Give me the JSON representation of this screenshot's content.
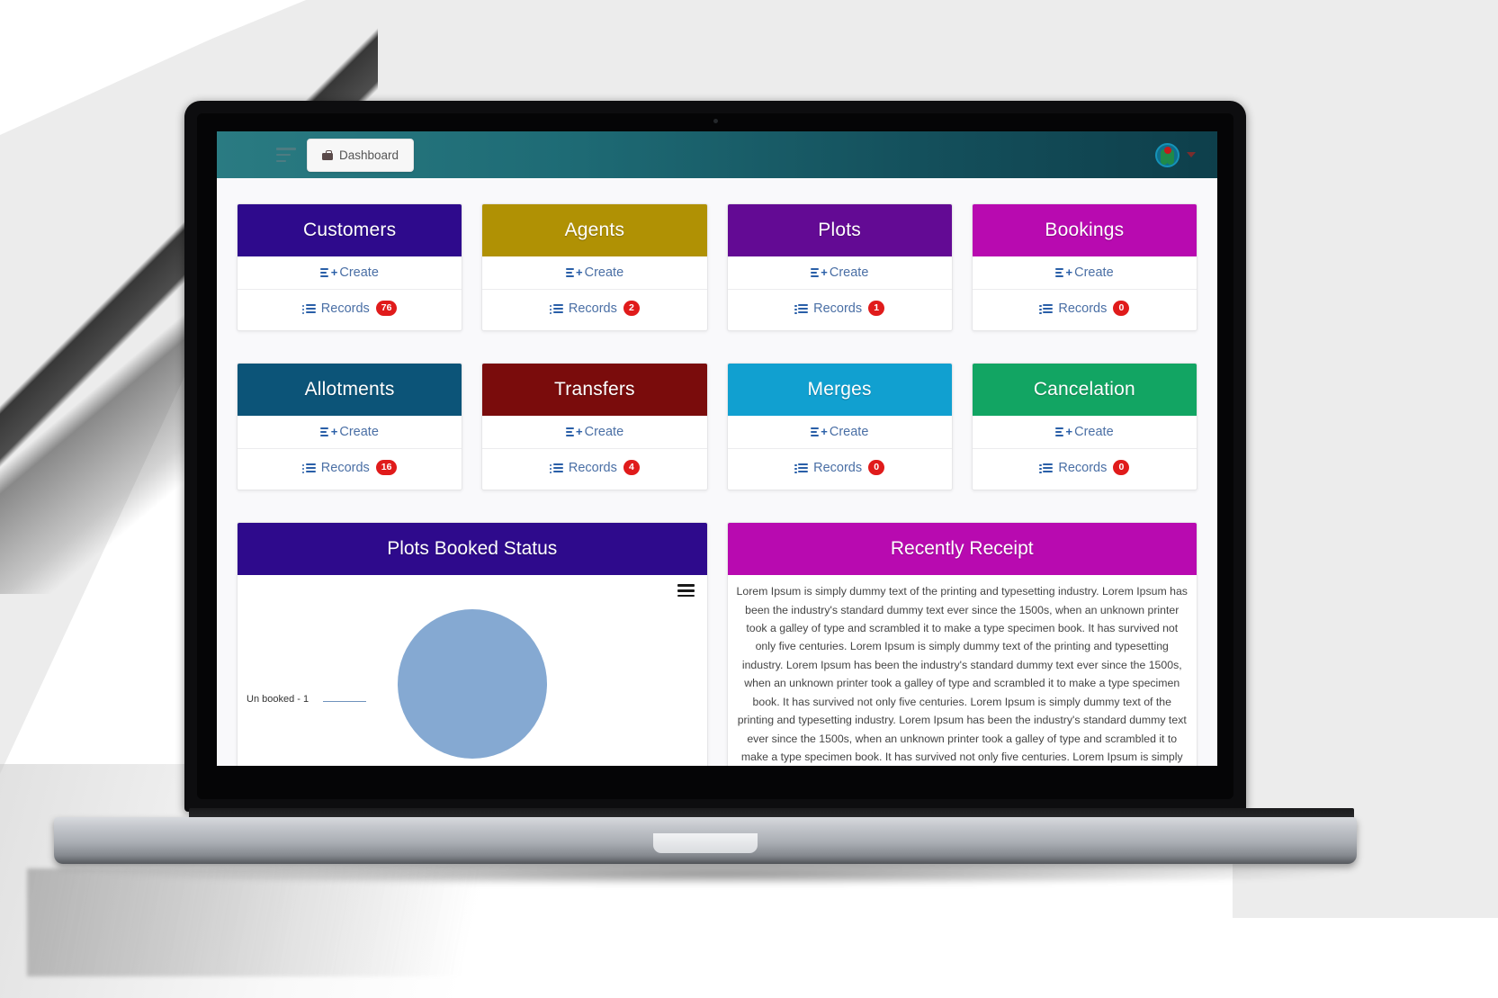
{
  "navbar": {
    "menu_icon": "sort-align-left-icon",
    "dashboard_label": "Dashboard",
    "dashboard_icon": "briefcase-icon",
    "avatar_icon": "user-avatar-logo",
    "caret_icon": "chevron-down-icon",
    "gradient_from": "#2a7b82",
    "gradient_to": "#0e3f4b"
  },
  "cards": [
    {
      "title": "Customers",
      "color": "#2e0a8c",
      "create_label": "Create",
      "records_label": "Records",
      "count": "76"
    },
    {
      "title": "Agents",
      "color": "#b09104",
      "create_label": "Create",
      "records_label": "Records",
      "count": "2"
    },
    {
      "title": "Plots",
      "color": "#630a94",
      "create_label": "Create",
      "records_label": "Records",
      "count": "1"
    },
    {
      "title": "Bookings",
      "color": "#b80ab0",
      "create_label": "Create",
      "records_label": "Records",
      "count": "0"
    },
    {
      "title": "Allotments",
      "color": "#0c5478",
      "create_label": "Create",
      "records_label": "Records",
      "count": "16"
    },
    {
      "title": "Transfers",
      "color": "#7a0c0c",
      "create_label": "Create",
      "records_label": "Records",
      "count": "4"
    },
    {
      "title": "Merges",
      "color": "#11a0d0",
      "create_label": "Create",
      "records_label": "Records",
      "count": "0"
    },
    {
      "title": "Cancelation",
      "color": "#12a563",
      "create_label": "Create",
      "records_label": "Records",
      "count": "0"
    }
  ],
  "panels": {
    "chart": {
      "title": "Plots Booked Status",
      "color": "#2e0a8c",
      "menu_icon": "hamburger-menu-icon"
    },
    "receipt": {
      "title": "Recently Receipt",
      "color": "#b80ab0",
      "body": "Lorem Ipsum is simply dummy text of the printing and typesetting industry. Lorem Ipsum has been the industry's standard dummy text ever since the 1500s, when an unknown printer took a galley of type and scrambled it to make a type specimen book. It has survived not only five centuries. Lorem Ipsum is simply dummy text of the printing and typesetting industry. Lorem Ipsum has been the industry's standard dummy text ever since the 1500s, when an unknown printer took a galley of type and scrambled it to make a type specimen book. It has survived not only five centuries. Lorem Ipsum is simply dummy text of the printing and typesetting industry. Lorem Ipsum has been the industry's standard dummy text ever since the 1500s, when an unknown printer took a galley of type and scrambled it to make a type specimen book. It has survived not only five centuries. Lorem Ipsum is simply dummy text of the printing and typesetting industry. Lorem Ipsum has been the industry's standard dummy text ever since the 1500s, when"
    }
  },
  "chart_data": {
    "type": "pie",
    "title": "Plots Booked Status",
    "categories": [
      "Un booked"
    ],
    "values": [
      1
    ],
    "labels": [
      "Un booked - 1"
    ],
    "colors": [
      "#85a9d2"
    ],
    "legend": "none",
    "annotations": [
      "Un booked - 1"
    ]
  }
}
